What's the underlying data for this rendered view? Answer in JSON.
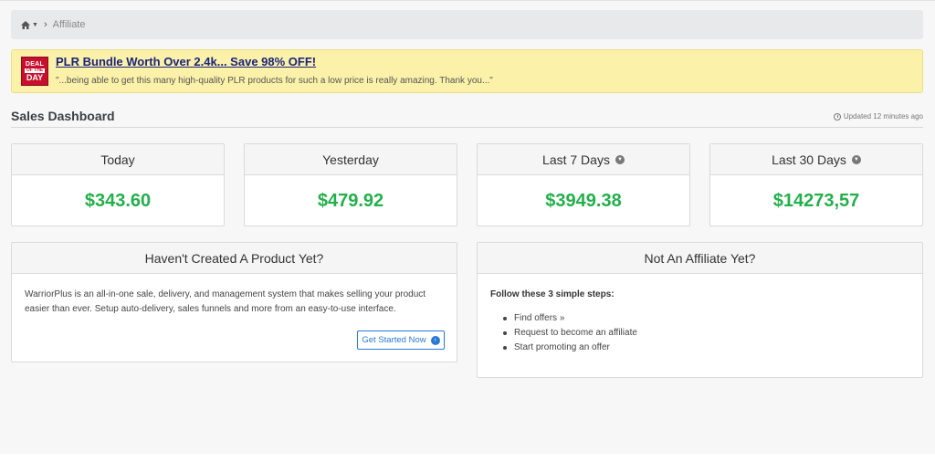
{
  "breadcrumb": {
    "home_icon": "home-icon",
    "current": "Affiliate"
  },
  "deal": {
    "badge_line1": "DEAL",
    "badge_line2": "OF THE",
    "badge_line3": "DAY",
    "title": "PLR Bundle Worth Over 2.4k... Save 98% OFF!",
    "quote": "\"...being able to get this many high-quality PLR products for such a low price is really amazing. Thank you...\""
  },
  "dashboard": {
    "title": "Sales Dashboard",
    "updated": "Updated 12 minutes ago"
  },
  "stats": [
    {
      "label": "Today",
      "value": "$343.60"
    },
    {
      "label": "Yesterday",
      "value": "$479.92"
    },
    {
      "label": "Last 7 Days",
      "value": "$3949.38"
    },
    {
      "label": "Last 30 Days",
      "value": "$14273,57"
    }
  ],
  "product_panel": {
    "title": "Haven't Created A Product Yet?",
    "body": "WarriorPlus is an all-in-one sale, delivery, and management system that makes selling your product easier than ever. Setup auto-delivery, sales funnels and more from an easy-to-use interface.",
    "button": "Get Started Now"
  },
  "affiliate_panel": {
    "title": "Not An Affiliate Yet?",
    "steps_title": "Follow these 3 simple steps:",
    "steps": [
      "Find offers »",
      "Request to become an affiliate",
      "Start promoting an offer"
    ]
  },
  "colors": {
    "accent_green": "#22b04b",
    "link_blue": "#2a7ad5",
    "deal_background": "#fbf1a9"
  }
}
